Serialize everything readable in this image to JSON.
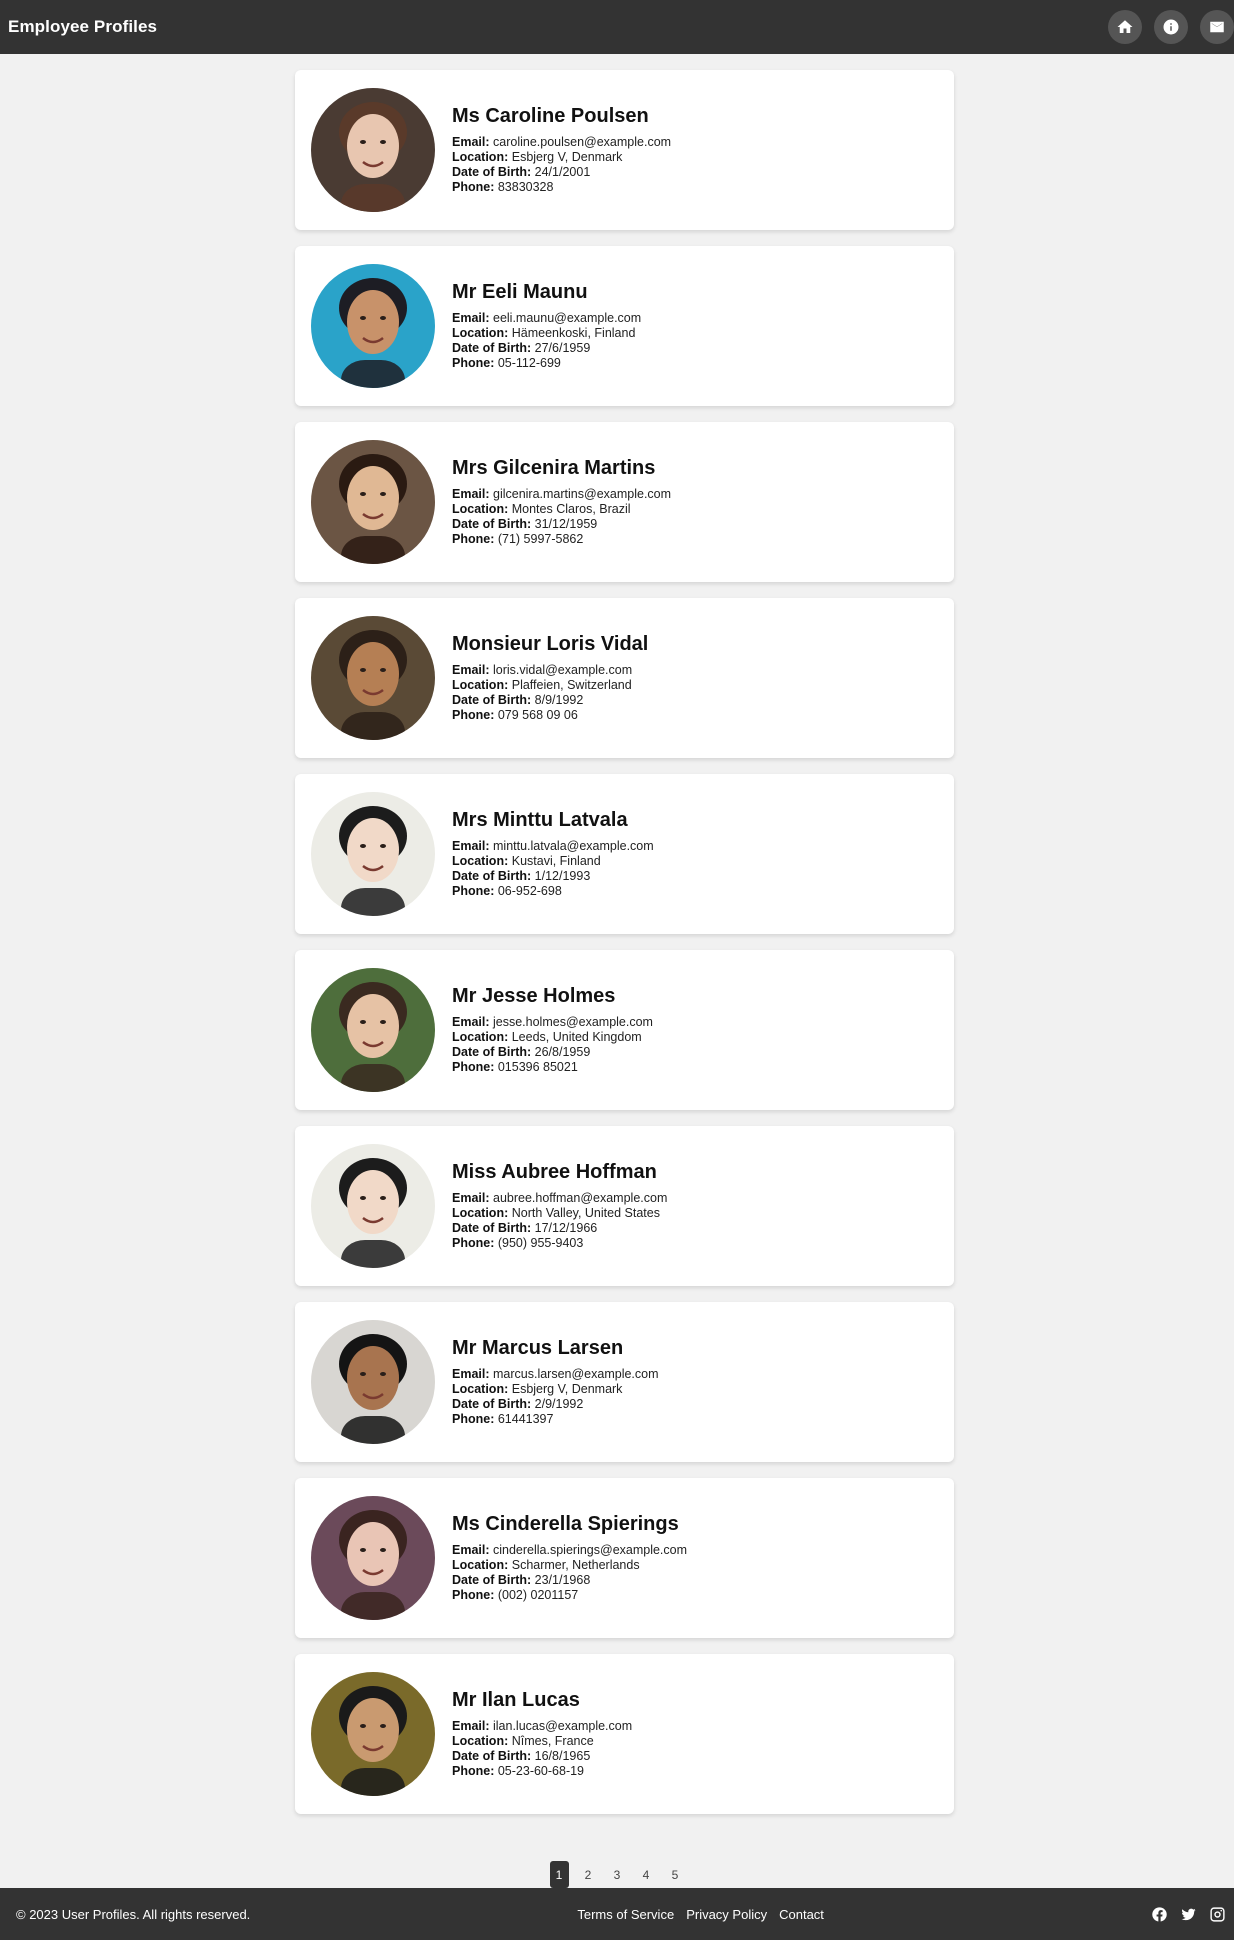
{
  "header": {
    "title": "Employee Profiles",
    "nav_icons": [
      "home-icon",
      "info-icon",
      "mail-icon"
    ]
  },
  "labels": {
    "email": "Email:",
    "location": "Location:",
    "dob": "Date of Birth:",
    "phone": "Phone:"
  },
  "profiles": [
    {
      "name": "Ms Caroline Poulsen",
      "email": "caroline.poulsen@example.com",
      "location": "Esbjerg V, Denmark",
      "dob": "24/1/2001",
      "phone": "83830328"
    },
    {
      "name": "Mr Eeli Maunu",
      "email": "eeli.maunu@example.com",
      "location": "Hämeenkoski, Finland",
      "dob": "27/6/1959",
      "phone": "05-112-699"
    },
    {
      "name": "Mrs Gilcenira Martins",
      "email": "gilcenira.martins@example.com",
      "location": "Montes Claros, Brazil",
      "dob": "31/12/1959",
      "phone": "(71) 5997-5862"
    },
    {
      "name": "Monsieur Loris Vidal",
      "email": "loris.vidal@example.com",
      "location": "Plaffeien, Switzerland",
      "dob": "8/9/1992",
      "phone": "079 568 09 06"
    },
    {
      "name": "Mrs Minttu Latvala",
      "email": "minttu.latvala@example.com",
      "location": "Kustavi, Finland",
      "dob": "1/12/1993",
      "phone": "06-952-698"
    },
    {
      "name": "Mr Jesse Holmes",
      "email": "jesse.holmes@example.com",
      "location": "Leeds, United Kingdom",
      "dob": "26/8/1959",
      "phone": "015396 85021"
    },
    {
      "name": "Miss Aubree Hoffman",
      "email": "aubree.hoffman@example.com",
      "location": "North Valley, United States",
      "dob": "17/12/1966",
      "phone": "(950) 955-9403"
    },
    {
      "name": "Mr Marcus Larsen",
      "email": "marcus.larsen@example.com",
      "location": "Esbjerg V, Denmark",
      "dob": "2/9/1992",
      "phone": "61441397"
    },
    {
      "name": "Ms Cinderella Spierings",
      "email": "cinderella.spierings@example.com",
      "location": "Scharmer, Netherlands",
      "dob": "23/1/1968",
      "phone": "(002) 0201157"
    },
    {
      "name": "Mr Ilan Lucas",
      "email": "ilan.lucas@example.com",
      "location": "Nîmes, France",
      "dob": "16/8/1965",
      "phone": "05-23-60-68-19"
    }
  ],
  "avatar_palette": [
    {
      "bg": "#4a3b33",
      "skin": "#e8c6b0",
      "hair": "#5a3a2a"
    },
    {
      "bg": "#2aa3c9",
      "skin": "#c8926a",
      "hair": "#1d1d24"
    },
    {
      "bg": "#6b5544",
      "skin": "#e0b894",
      "hair": "#2a1a12"
    },
    {
      "bg": "#5a4a36",
      "skin": "#b57f54",
      "hair": "#2c2018"
    },
    {
      "bg": "#ecece6",
      "skin": "#f1d9c8",
      "hair": "#1c1c1c"
    },
    {
      "bg": "#4e6e3c",
      "skin": "#e6c2a5",
      "hair": "#3a2a20"
    },
    {
      "bg": "#ecece6",
      "skin": "#f1d9c8",
      "hair": "#1c1c1c"
    },
    {
      "bg": "#d8d6d2",
      "skin": "#a8744f",
      "hair": "#141414"
    },
    {
      "bg": "#6b4a5a",
      "skin": "#e9c5b5",
      "hair": "#3a2420"
    },
    {
      "bg": "#7a6a2a",
      "skin": "#c99a70",
      "hair": "#1a1a1a"
    }
  ],
  "pagination": {
    "pages": [
      "1",
      "2",
      "3",
      "4",
      "5"
    ],
    "active": "1"
  },
  "footer": {
    "copyright": "© 2023 User Profiles. All rights reserved.",
    "links": [
      "Terms of Service",
      "Privacy Policy",
      "Contact"
    ],
    "social_icons": [
      "facebook-icon",
      "twitter-icon",
      "instagram-icon"
    ]
  }
}
